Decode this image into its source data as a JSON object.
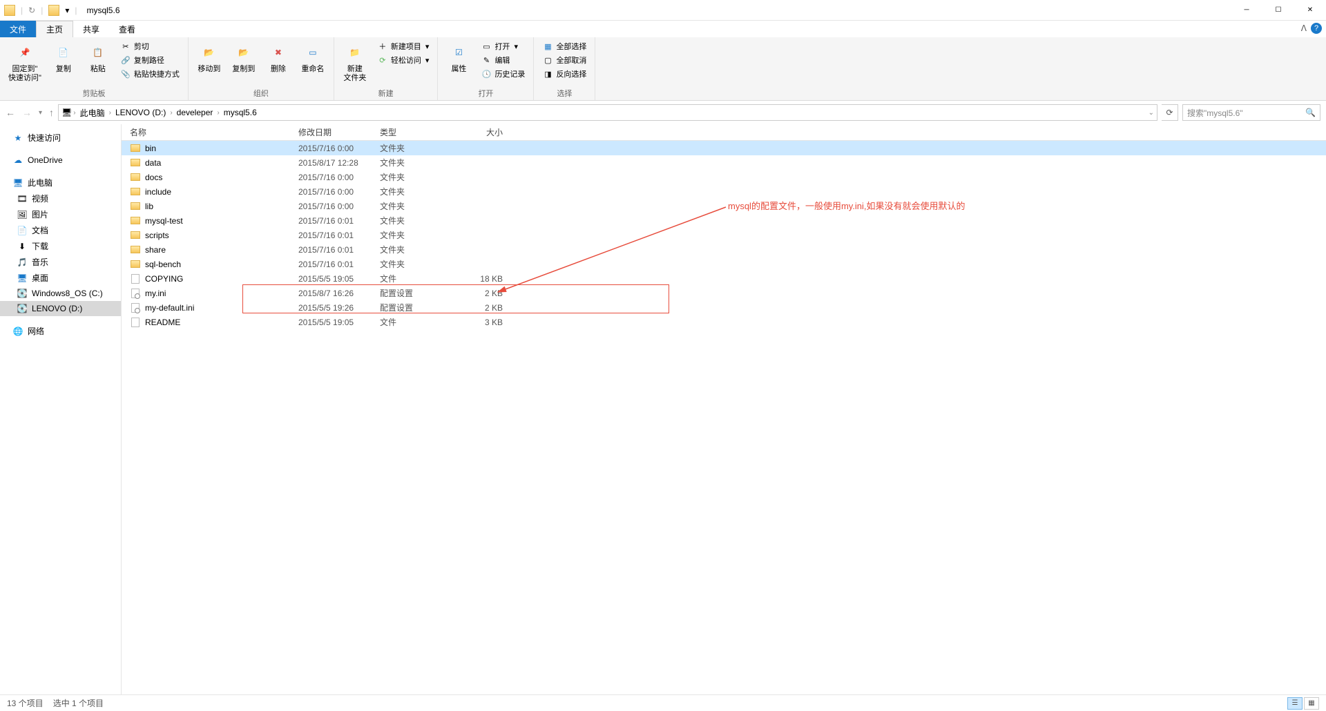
{
  "titlebar": {
    "title": "mysql5.6"
  },
  "tabs": {
    "file": "文件",
    "home": "主页",
    "share": "共享",
    "view": "查看"
  },
  "ribbon": {
    "clipboard": {
      "label": "剪贴板",
      "pin": "固定到\"\n快速访问\"",
      "copy": "复制",
      "paste": "粘贴",
      "cut": "剪切",
      "copy_path": "复制路径",
      "paste_shortcut": "粘贴快捷方式"
    },
    "organize": {
      "label": "组织",
      "move_to": "移动到",
      "copy_to": "复制到",
      "delete": "删除",
      "rename": "重命名"
    },
    "new": {
      "label": "新建",
      "new_folder": "新建\n文件夹",
      "new_item": "新建项目",
      "easy_access": "轻松访问"
    },
    "open": {
      "label": "打开",
      "properties": "属性",
      "open": "打开",
      "edit": "编辑",
      "history": "历史记录"
    },
    "select": {
      "label": "选择",
      "select_all": "全部选择",
      "select_none": "全部取消",
      "invert": "反向选择"
    }
  },
  "breadcrumb": {
    "items": [
      "此电脑",
      "LENOVO (D:)",
      "develeper",
      "mysql5.6"
    ]
  },
  "search": {
    "placeholder": "搜索\"mysql5.6\""
  },
  "sidebar": {
    "quick_access": "快速访问",
    "onedrive": "OneDrive",
    "this_pc": "此电脑",
    "videos": "视频",
    "pictures": "图片",
    "documents": "文档",
    "downloads": "下载",
    "music": "音乐",
    "desktop": "桌面",
    "c_drive": "Windows8_OS (C:)",
    "d_drive": "LENOVO (D:)",
    "network": "网络"
  },
  "columns": {
    "name": "名称",
    "date": "修改日期",
    "type": "类型",
    "size": "大小"
  },
  "files": [
    {
      "name": "bin",
      "date": "2015/7/16 0:00",
      "type": "文件夹",
      "size": "",
      "icon": "folder",
      "selected": true
    },
    {
      "name": "data",
      "date": "2015/8/17 12:28",
      "type": "文件夹",
      "size": "",
      "icon": "folder"
    },
    {
      "name": "docs",
      "date": "2015/7/16 0:00",
      "type": "文件夹",
      "size": "",
      "icon": "folder"
    },
    {
      "name": "include",
      "date": "2015/7/16 0:00",
      "type": "文件夹",
      "size": "",
      "icon": "folder"
    },
    {
      "name": "lib",
      "date": "2015/7/16 0:00",
      "type": "文件夹",
      "size": "",
      "icon": "folder"
    },
    {
      "name": "mysql-test",
      "date": "2015/7/16 0:01",
      "type": "文件夹",
      "size": "",
      "icon": "folder"
    },
    {
      "name": "scripts",
      "date": "2015/7/16 0:01",
      "type": "文件夹",
      "size": "",
      "icon": "folder"
    },
    {
      "name": "share",
      "date": "2015/7/16 0:01",
      "type": "文件夹",
      "size": "",
      "icon": "folder"
    },
    {
      "name": "sql-bench",
      "date": "2015/7/16 0:01",
      "type": "文件夹",
      "size": "",
      "icon": "folder"
    },
    {
      "name": "COPYING",
      "date": "2015/5/5 19:05",
      "type": "文件",
      "size": "18 KB",
      "icon": "file"
    },
    {
      "name": "my.ini",
      "date": "2015/8/7 16:26",
      "type": "配置设置",
      "size": "2 KB",
      "icon": "ini"
    },
    {
      "name": "my-default.ini",
      "date": "2015/5/5 19:26",
      "type": "配置设置",
      "size": "2 KB",
      "icon": "ini"
    },
    {
      "name": "README",
      "date": "2015/5/5 19:05",
      "type": "文件",
      "size": "3 KB",
      "icon": "file"
    }
  ],
  "annotation": "mysql的配置文件，一般使用my.ini,如果没有就会使用默认的",
  "statusbar": {
    "count": "13 个项目",
    "selected": "选中 1 个项目"
  }
}
